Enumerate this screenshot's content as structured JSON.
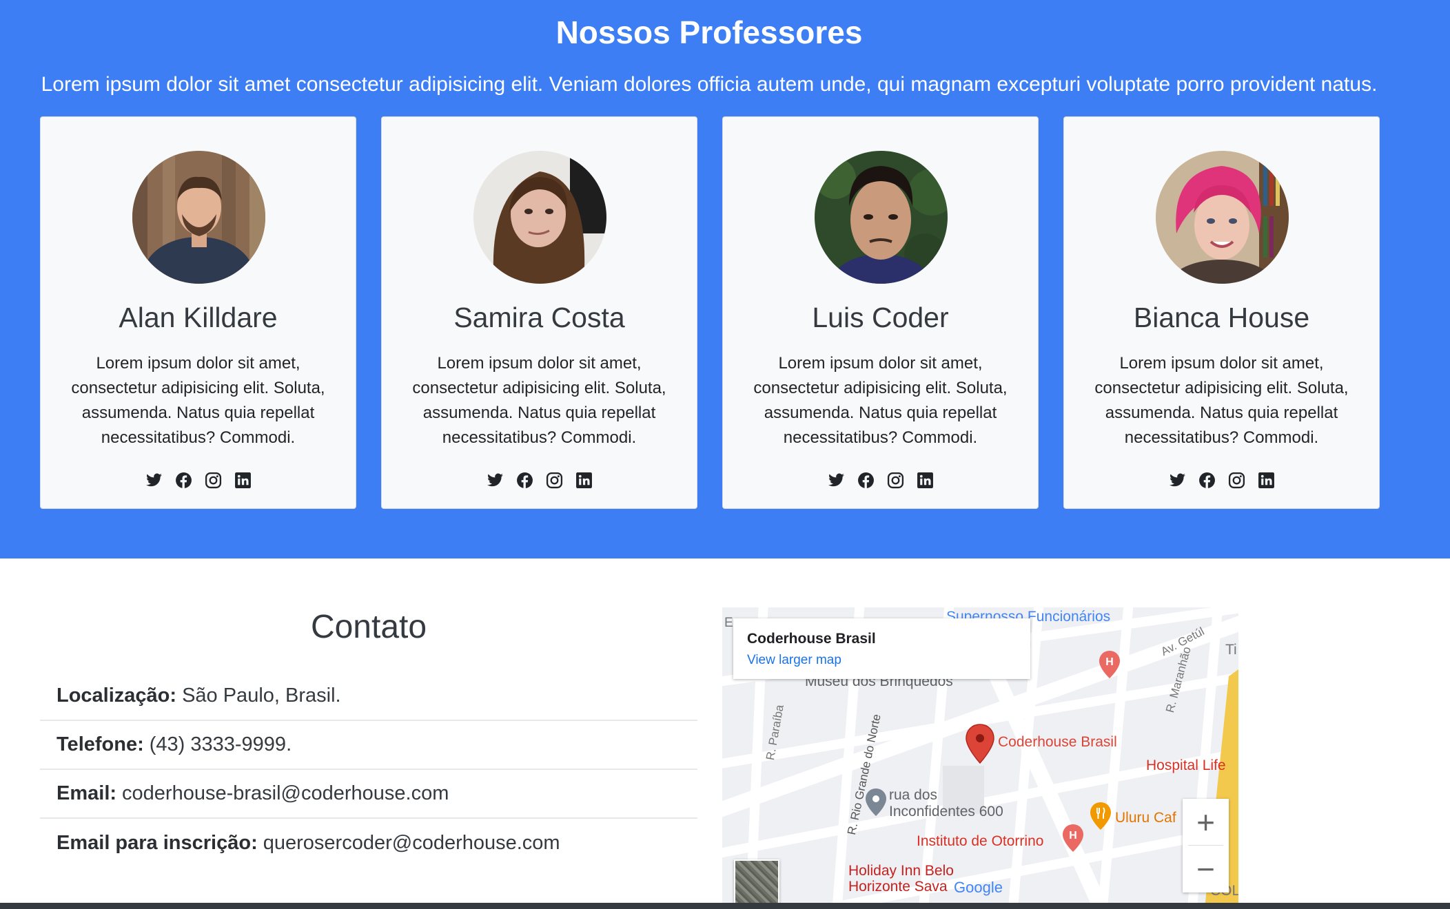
{
  "teachers": {
    "title": "Nossos Professores",
    "lead": "Lorem ipsum dolor sit amet consectetur adipisicing elit. Veniam dolores officia autem unde, qui magnam excepturi voluptate porro provident natus.",
    "cards": [
      {
        "name": "Alan Killdare",
        "bio": "Lorem ipsum dolor sit amet, consectetur adipisicing elit. Soluta, assumenda. Natus quia repellat necessitatibus? Commodi."
      },
      {
        "name": "Samira Costa",
        "bio": "Lorem ipsum dolor sit amet, consectetur adipisicing elit. Soluta, assumenda. Natus quia repellat necessitatibus? Commodi."
      },
      {
        "name": "Luis Coder",
        "bio": "Lorem ipsum dolor sit amet, consectetur adipisicing elit. Soluta, assumenda. Natus quia repellat necessitatibus? Commodi."
      },
      {
        "name": "Bianca House",
        "bio": "Lorem ipsum dolor sit amet, consectetur adipisicing elit. Soluta, assumenda. Natus quia repellat necessitatibus? Commodi."
      }
    ],
    "social_icons": [
      "twitter-icon",
      "facebook-icon",
      "instagram-icon",
      "linkedin-icon"
    ]
  },
  "contact": {
    "title": "Contato",
    "rows": [
      {
        "label": "Localização:",
        "value": "São Paulo, Brasil."
      },
      {
        "label": "Telefone:",
        "value": "(43) 3333-9999."
      },
      {
        "label": "Email:",
        "value": "coderhouse-brasil@coderhouse.com"
      },
      {
        "label": "Email para inscrição:",
        "value": "querosercoder@coderhouse.com"
      }
    ]
  },
  "map": {
    "place_name": "Coderhouse Brasil",
    "view_larger": "View larger map",
    "labels": {
      "funcionarios": "Supernosso Funcionários",
      "museu": "Museu dos Brinquedos",
      "av_getulio": "Av. Getúl",
      "maranhao": "R. Maranhão",
      "paraiba": "R. Paraíba",
      "rio_grande": "R. Rio Grande do Norte",
      "marker": "Coderhouse Brasil",
      "hospital": "Hospital Life",
      "rua_dos_1": "rua dos",
      "rua_dos_2": "Inconfidentes 600",
      "uluru": "Uluru Caf",
      "instituto": "Instituto de Otorrino",
      "holiday_1": "Holiday Inn Belo",
      "holiday_2": "Horizonte Sava",
      "google": "Google",
      "ti": "Ti",
      "col": "COL",
      "es": "Es"
    },
    "zoom_in": "+",
    "zoom_out": "−"
  },
  "colors": {
    "primary": "#3d7ef5",
    "card": "#f8f9fa",
    "marker": "#db4437",
    "link": "#1a73e8"
  }
}
